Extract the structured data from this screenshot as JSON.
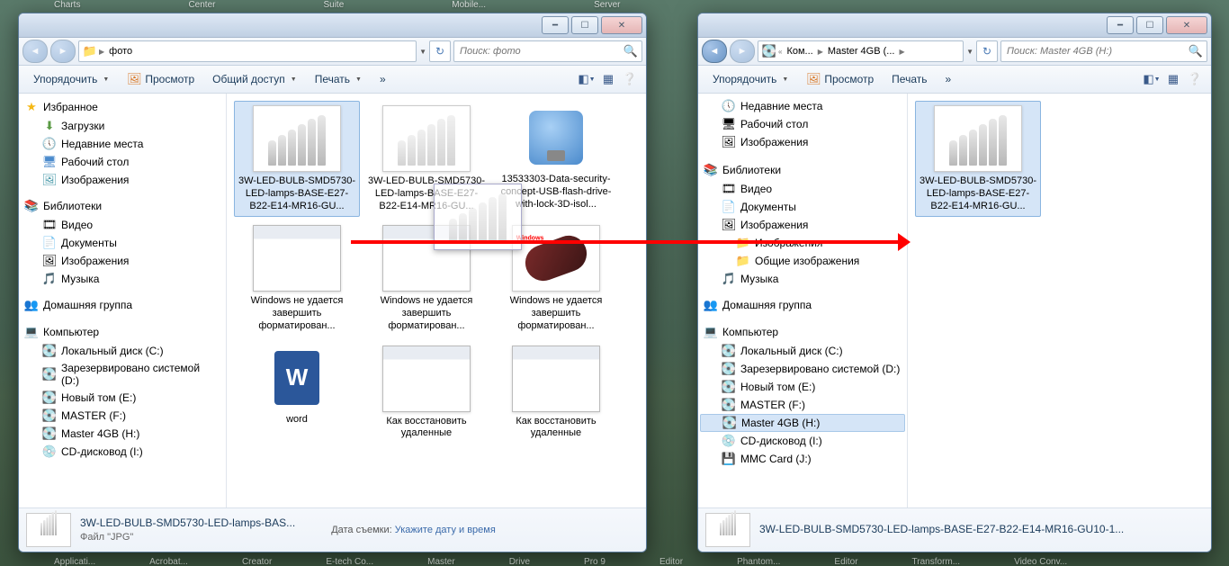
{
  "topbar": [
    "Charts",
    "Center",
    "Suite",
    "Mobile...",
    "Server"
  ],
  "bottombar": [
    "Applicati...",
    "Acrobat...",
    "Creator",
    "E-tech Co...",
    "Master",
    "Drive",
    "Pro 9",
    "Editor",
    "Phantom...",
    "Editor",
    "Transform...",
    "Video Conv..."
  ],
  "winA": {
    "addr": {
      "segs": [
        "",
        "фото"
      ]
    },
    "search_ph": "Поиск: фото",
    "toolbar": {
      "org": "Упорядочить",
      "view": "Просмотр",
      "share": "Общий доступ",
      "print": "Печать"
    },
    "nav": {
      "fav": {
        "head": "Избранное",
        "items": [
          "Загрузки",
          "Недавние места",
          "Рабочий стол",
          "Изображения"
        ]
      },
      "lib": {
        "head": "Библиотеки",
        "items": [
          "Видео",
          "Документы",
          "Изображения",
          "Музыка"
        ]
      },
      "home": {
        "head": "Домашняя группа"
      },
      "comp": {
        "head": "Компьютер",
        "items": [
          "Локальный диск (C:)",
          "Зарезервировано системой (D:)",
          "Новый том (E:)",
          "MASTER (F:)",
          "Master 4GB (H:)",
          "CD-дисковод (I:)"
        ]
      }
    },
    "files_row1": [
      "3W-LED-BULB-SMD5730-LED-lamps-BASE-E27-B22-E14-MR16-GU...",
      "3W-LED-BULB-SMD5730-LED-lamps-BASE-E27-B22-E14-MR16-GU...",
      "13533303-Data-security-concept-USB-flash-drive-with-lock-3D-isol..."
    ],
    "files_row2": [
      "Windows не удается завершить форматирован...",
      "Windows не удается завершить форматирован...",
      "Windows не удается завершить форматирован..."
    ],
    "files_row3": [
      "word",
      "Как восстановить удаленные",
      "Как восстановить удаленные"
    ],
    "details": {
      "name": "3W-LED-BULB-SMD5730-LED-lamps-BAS...",
      "type": "Файл \"JPG\"",
      "meta_l": "Дата съемки:",
      "meta_v": "Укажите дату и время"
    }
  },
  "winB": {
    "addr": {
      "segs": [
        "",
        "Ком...",
        "Master 4GB (..."
      ]
    },
    "search_ph": "Поиск: Master 4GB (H:)",
    "toolbar": {
      "org": "Упорядочить",
      "view": "Просмотр",
      "print": "Печать"
    },
    "nav": {
      "recent": "Недавние места",
      "desk": "Рабочий стол",
      "img": "Изображения",
      "lib": {
        "head": "Библиотеки",
        "items": [
          "Видео",
          "Документы",
          "Изображения",
          "Музыка"
        ],
        "sub": [
          "Изображения",
          "Общие изображения"
        ]
      },
      "home": {
        "head": "Домашняя группа"
      },
      "comp": {
        "head": "Компьютер",
        "items": [
          "Локальный диск (C:)",
          "Зарезервировано системой (D:)",
          "Новый том (E:)",
          "MASTER (F:)",
          "Master 4GB (H:)",
          "CD-дисковод (I:)",
          "MMC Card (J:)"
        ]
      }
    },
    "file": "3W-LED-BULB-SMD5730-LED-lamps-BASE-E27-B22-E14-MR16-GU...",
    "details": {
      "name": "3W-LED-BULB-SMD5730-LED-lamps-BASE-E27-B22-E14-MR16-GU10-1..."
    }
  }
}
